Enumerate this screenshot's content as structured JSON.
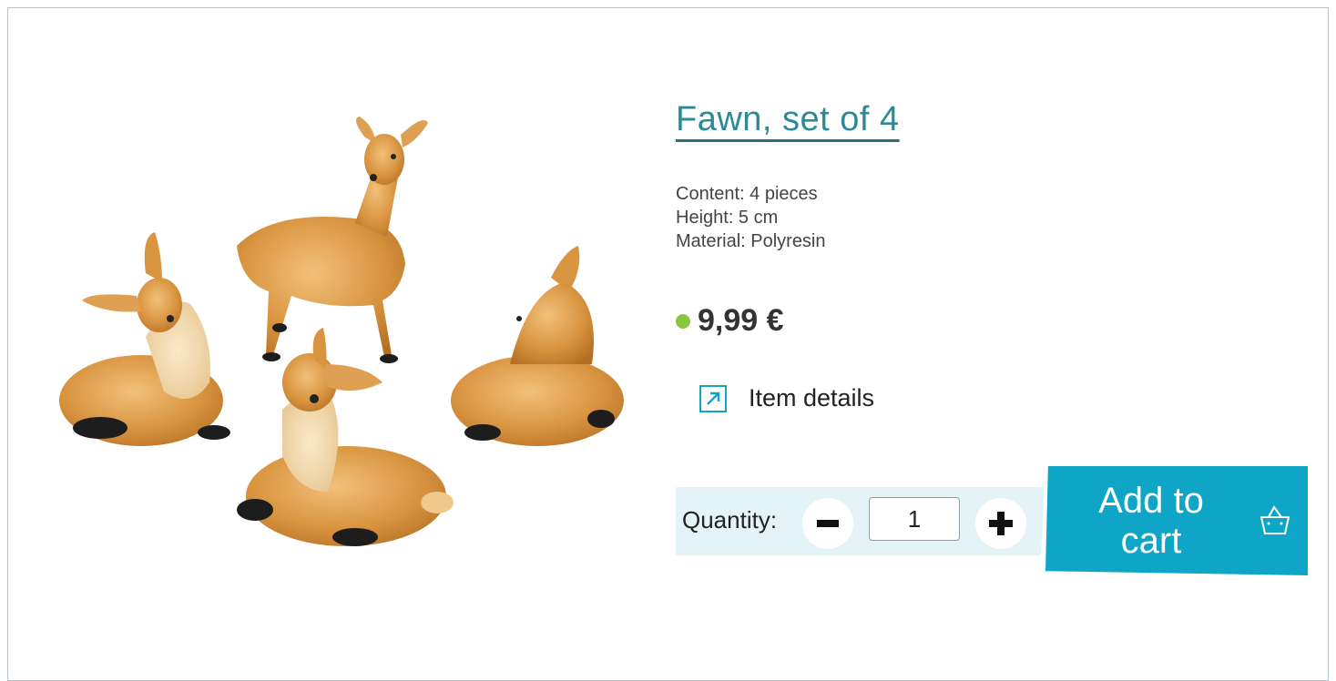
{
  "product": {
    "title": "Fawn, set of 4",
    "specs": [
      "Content: 4 pieces",
      "Height: 5 cm",
      "Material: Polyresin"
    ],
    "price": "9,99 €",
    "availability_color": "#8cc63f",
    "image_alt": "Four fawn figurines"
  },
  "details_link": {
    "label": "Item details",
    "icon": "external-link-arrow-icon"
  },
  "quantity": {
    "label": "Quantity:",
    "value": "1",
    "minus_icon": "minus-icon",
    "plus_icon": "plus-icon"
  },
  "cart": {
    "label_line1": "Add to",
    "label_line2": "cart",
    "icon": "basket-icon"
  },
  "colors": {
    "accent": "#0ea5c6",
    "title": "#2b8a96",
    "band": "#e4f3f8"
  }
}
